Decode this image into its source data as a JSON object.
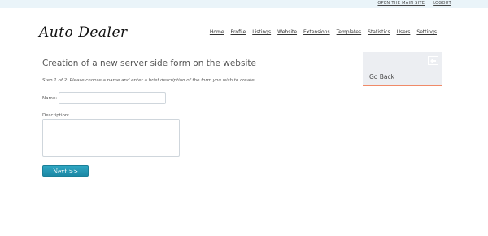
{
  "topbar": {
    "open_main_site": "OPEN THE MAIN SITE",
    "logout": "LOGOUT"
  },
  "brand": {
    "title": "Auto Dealer"
  },
  "nav": {
    "items": [
      {
        "label": "Home"
      },
      {
        "label": "Profile"
      },
      {
        "label": "Listings"
      },
      {
        "label": "Website"
      },
      {
        "label": "Extensions"
      },
      {
        "label": "Templates"
      },
      {
        "label": "Statistics"
      },
      {
        "label": "Users"
      },
      {
        "label": "Settings"
      }
    ]
  },
  "main": {
    "title": "Creation of a new server side form on the website",
    "step_text": "Step 1 of 2: Please choose a name and enter a brief description of the form you wish to create",
    "name_label": "Name:",
    "name_value": "",
    "description_label": "Description:",
    "description_value": "",
    "next_label": "Next >>"
  },
  "sidebar": {
    "go_back_label": "Go Back",
    "go_back_icon": "go-back-icon"
  },
  "colors": {
    "accent": "#1c88a5",
    "go_back_border": "#f08a68",
    "topbar_bg": "#eaf4f9"
  }
}
